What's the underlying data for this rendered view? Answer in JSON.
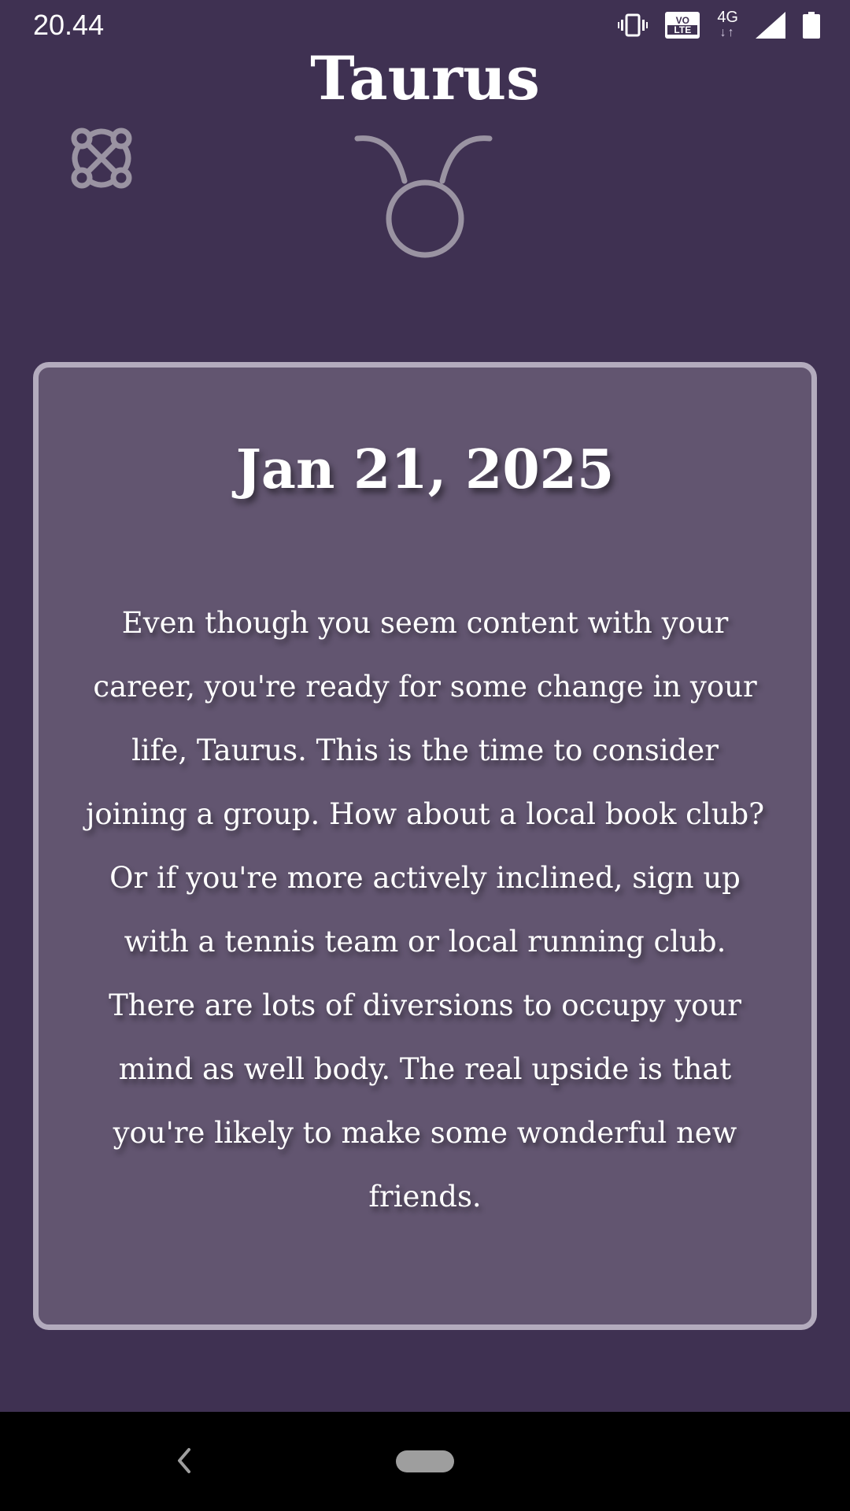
{
  "status_bar": {
    "time": "20.44",
    "volte_top": "VO",
    "volte_bottom": "LTE",
    "network": "4G",
    "network_arrows": "↓↑"
  },
  "header": {
    "title": "Taurus",
    "menu_icon": "celtic-knot-icon",
    "sign_icon": "taurus-symbol-icon"
  },
  "horoscope": {
    "date": "Jan 21, 2025",
    "text": "Even though you seem content with your career, you're ready for some change in your life, Taurus. This is the time to consider joining a group. How about a local book club? Or if you're more actively inclined, sign up with a tennis team or local running club. There are lots of diversions to occupy your mind as well body. The real upside is that you're likely to make some wonderful new friends."
  },
  "nav": {
    "back_icon": "back-chevron-icon",
    "home_icon": "home-pill-icon"
  },
  "colors": {
    "background": "#3f3152",
    "card_background": "#625570",
    "card_border": "#b3abbd",
    "icon_gray": "#9a93a2"
  }
}
